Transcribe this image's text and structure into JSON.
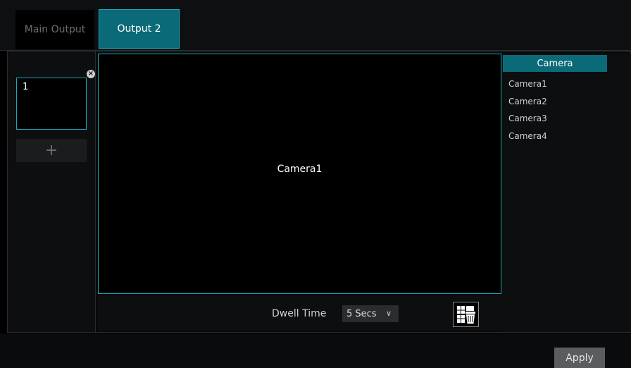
{
  "tabs": [
    {
      "label": "Main Output",
      "active": false
    },
    {
      "label": "Output 2",
      "active": true
    }
  ],
  "sequence": {
    "items": [
      {
        "number": "1"
      }
    ],
    "add_label": "+"
  },
  "preview": {
    "camera_label": "Camera1"
  },
  "dwell": {
    "label": "Dwell Time",
    "value": "5 Secs",
    "arrow": "∨"
  },
  "camera_list": {
    "header": "Camera",
    "items": [
      "Camera1",
      "Camera2",
      "Camera3",
      "Camera4"
    ]
  },
  "footer": {
    "apply_label": "Apply"
  },
  "colors": {
    "accent": "#0b6a78",
    "accent_border": "#1aa8bb",
    "background": "#000000"
  },
  "icons": {
    "remove": "close-x-icon",
    "clear": "trash-icon",
    "add": "plus-icon"
  }
}
